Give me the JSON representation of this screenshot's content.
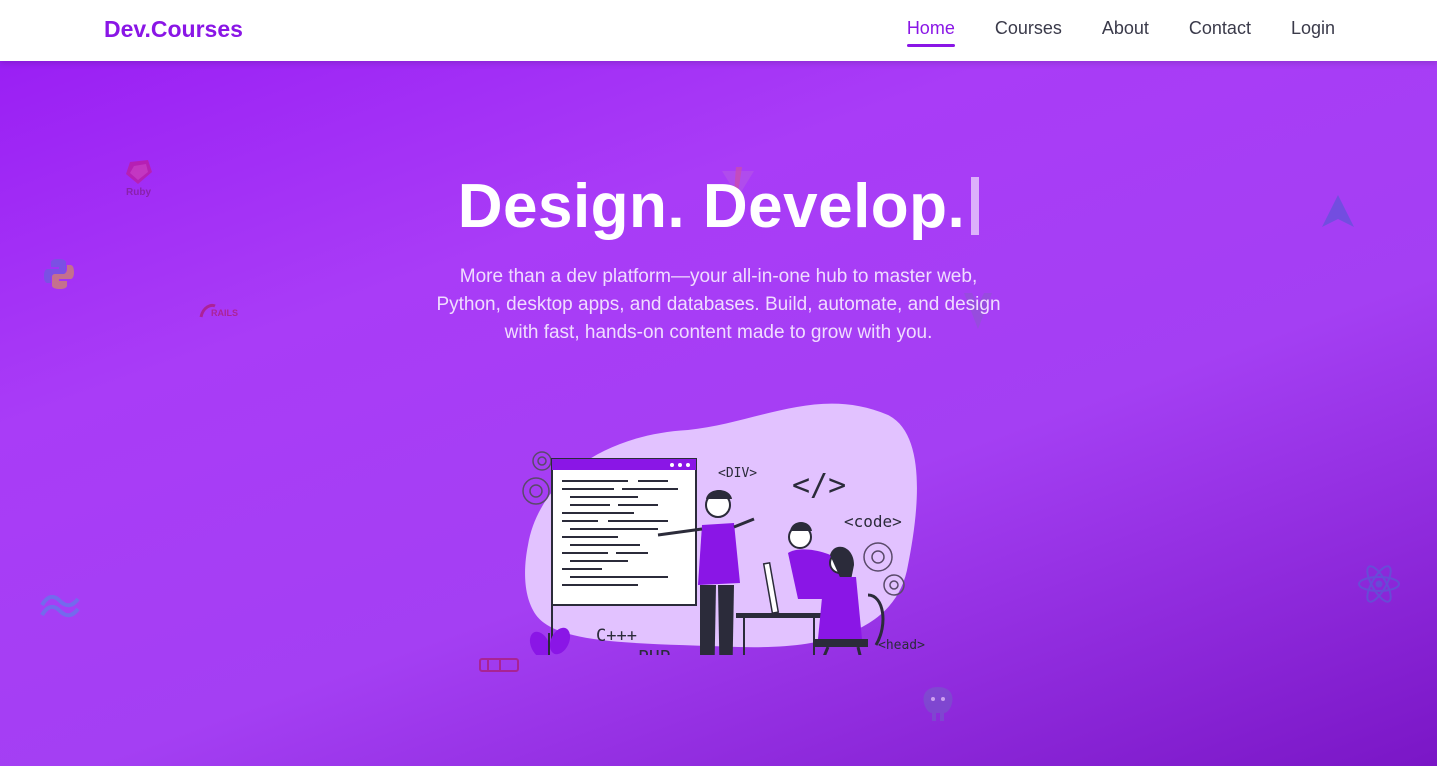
{
  "navbar": {
    "brand": "Dev.Courses",
    "links": [
      {
        "label": "Home",
        "active": true
      },
      {
        "label": "Courses",
        "active": false
      },
      {
        "label": "About",
        "active": false
      },
      {
        "label": "Contact",
        "active": false
      },
      {
        "label": "Login",
        "active": false
      }
    ]
  },
  "hero": {
    "title": "Design. Develop.",
    "subtitle": "More than a dev platform—your all-in-one hub to master web, Python, desktop apps, and databases. Build, automate, and design with fast, hands-on content made to grow with you."
  },
  "floating_icons": {
    "ruby": "Ruby",
    "rails": "RAILS"
  },
  "illustration": {
    "tags": [
      "<DIV>",
      "</>",
      "<code>",
      "C+++",
      "PHP",
      "<head>"
    ]
  },
  "colors": {
    "brand": "#8a16e6",
    "hero_start": "#9a1ff4",
    "hero_end": "#7a16c6",
    "illustration_blob": "#e2c2ff"
  }
}
